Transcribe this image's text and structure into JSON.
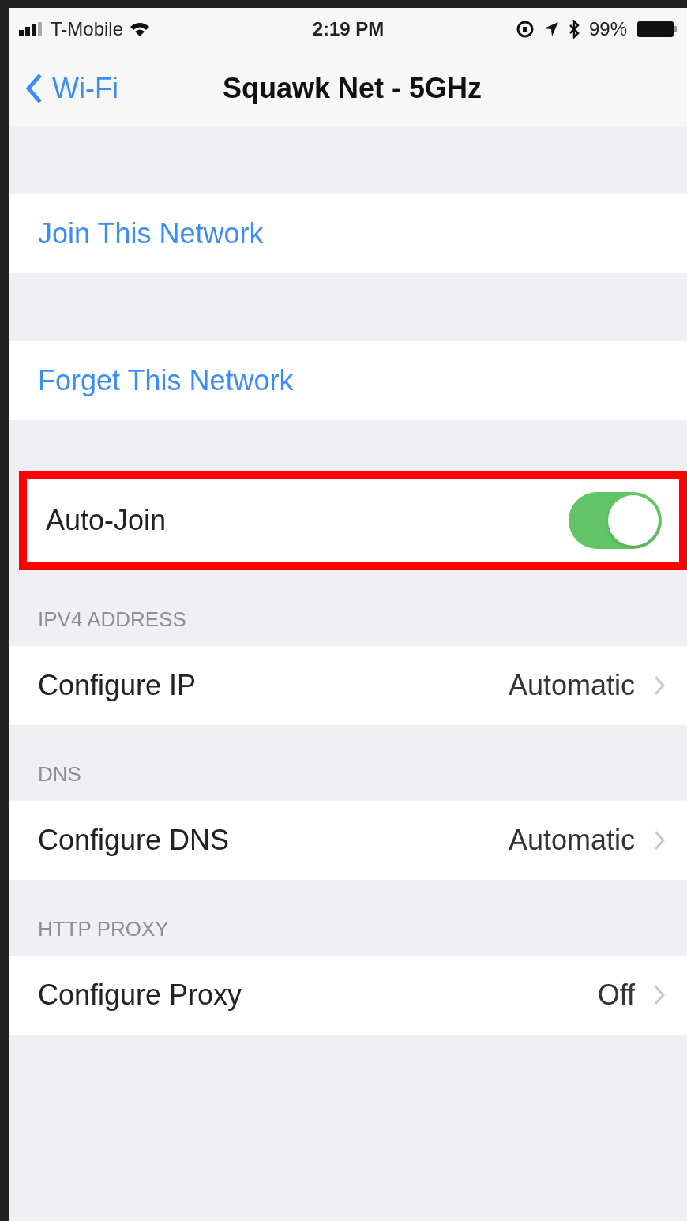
{
  "status_bar": {
    "carrier": "T-Mobile",
    "time": "2:19 PM",
    "battery": "99%"
  },
  "nav": {
    "back": "Wi-Fi",
    "title": "Squawk Net - 5GHz"
  },
  "sections": [
    {
      "kind": "action",
      "label": "Join This Network",
      "highlighted": false
    },
    {
      "kind": "action",
      "label": "Forget This Network",
      "highlighted": false
    },
    {
      "kind": "toggle",
      "label": "Auto-Join",
      "on": true,
      "highlighted": true
    },
    {
      "kind": "detail",
      "header": "IPV4 ADDRESS",
      "label": "Configure IP",
      "value": "Automatic",
      "highlighted": false
    },
    {
      "kind": "detail",
      "header": "DNS",
      "label": "Configure DNS",
      "value": "Automatic",
      "highlighted": false
    },
    {
      "kind": "detail",
      "header": "HTTP PROXY",
      "label": "Configure Proxy",
      "value": "Off",
      "highlighted": false
    }
  ]
}
